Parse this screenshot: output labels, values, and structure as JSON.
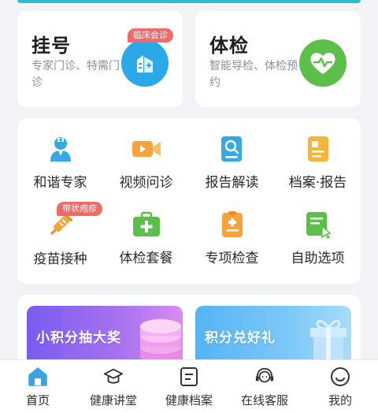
{
  "top_cards": {
    "registration": {
      "title": "挂号",
      "desc": "专家门诊、特需门诊",
      "tag": "临床会诊",
      "icon": "hospital-building-icon",
      "color": "#2aa8e8"
    },
    "checkup": {
      "title": "体检",
      "desc": "智能导检、体检预约",
      "icon": "heart-pulse-icon",
      "color": "#5cbf4a"
    }
  },
  "services": [
    {
      "label": "和谐专家",
      "icon": "doctor-icon",
      "color": "#35a8e6"
    },
    {
      "label": "视频问诊",
      "icon": "video-camera-icon",
      "color": "#f7a23a"
    },
    {
      "label": "报告解读",
      "icon": "report-search-icon",
      "color": "#35a8e6"
    },
    {
      "label": "档案·报告",
      "icon": "file-record-icon",
      "color": "#f7b43a"
    },
    {
      "label": "疫苗接种",
      "icon": "syringe-icon",
      "color": "#f7a23a",
      "tag": "带状疱疹"
    },
    {
      "label": "体检套餐",
      "icon": "medical-kit-icon",
      "color": "#5cbf4a"
    },
    {
      "label": "专项检查",
      "icon": "clipboard-plus-icon",
      "color": "#f7a23a"
    },
    {
      "label": "自助选项",
      "icon": "self-service-icon",
      "color": "#5cbf4a"
    }
  ],
  "banners": {
    "left": "小积分抽大奖",
    "right": "积分兑好礼"
  },
  "bottom_nav": [
    {
      "label": "首页",
      "icon": "home-icon",
      "active": true
    },
    {
      "label": "健康讲堂",
      "icon": "graduation-cap-icon"
    },
    {
      "label": "健康档案",
      "icon": "health-record-icon"
    },
    {
      "label": "在线客服",
      "icon": "headset-icon"
    },
    {
      "label": "我的",
      "icon": "smiley-profile-icon"
    }
  ],
  "colors": {
    "accent": "#2bbfcf",
    "page_bg": "#f1f3f6",
    "tag_red": "#f06a6a"
  }
}
